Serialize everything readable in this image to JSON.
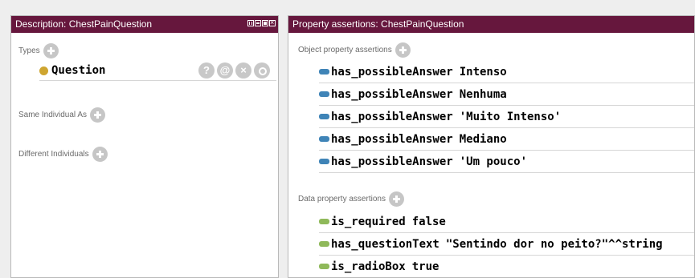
{
  "description_pane": {
    "title": "Description: ChestPainQuestion",
    "types_label": "Types",
    "type_value": "Question",
    "same_individual_label": "Same Individual As",
    "different_individuals_label": "Different Individuals",
    "action_icons": [
      "help-icon",
      "annotate-icon",
      "delete-icon",
      "edit-icon"
    ]
  },
  "property_pane": {
    "title": "Property assertions: ChestPainQuestion",
    "object_label": "Object property assertions",
    "object_assertions": [
      {
        "property": "has_possibleAnswer",
        "value": "Intenso"
      },
      {
        "property": "has_possibleAnswer",
        "value": "Nenhuma"
      },
      {
        "property": "has_possibleAnswer",
        "value": "'Muito Intenso'"
      },
      {
        "property": "has_possibleAnswer",
        "value": "Mediano"
      },
      {
        "property": "has_possibleAnswer",
        "value": "'Um pouco'"
      }
    ],
    "data_label": "Data property assertions",
    "data_assertions": [
      {
        "property": "is_required",
        "value": "false"
      },
      {
        "property": "has_questionText",
        "value": "\"Sentindo dor no peito?\"^^string"
      },
      {
        "property": "is_radioBox",
        "value": "true"
      }
    ]
  },
  "colors": {
    "titlebar": "#66173d",
    "class_dot": "#cea530",
    "object_property": "#3f84b7",
    "data_property": "#8fb95a"
  }
}
